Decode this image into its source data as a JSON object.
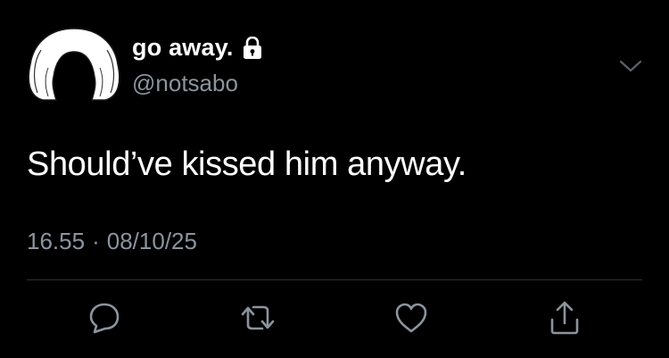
{
  "user": {
    "display_name": "go away.",
    "handle": "@notsabo",
    "locked": true
  },
  "tweet": {
    "text": "Should’ve kissed him anyway.",
    "time": "16.55",
    "separator": "·",
    "date": "08/10/25"
  },
  "icons": {
    "avatar": "default-avatar-silhouette",
    "lock": "lock-icon",
    "more": "chevron-down-icon",
    "reply": "reply-icon",
    "retweet": "retweet-icon",
    "like": "heart-icon",
    "share": "share-icon"
  },
  "colors": {
    "background": "#000000",
    "text": "#ffffff",
    "muted": "#8b949e",
    "divider": "#2f3336"
  }
}
